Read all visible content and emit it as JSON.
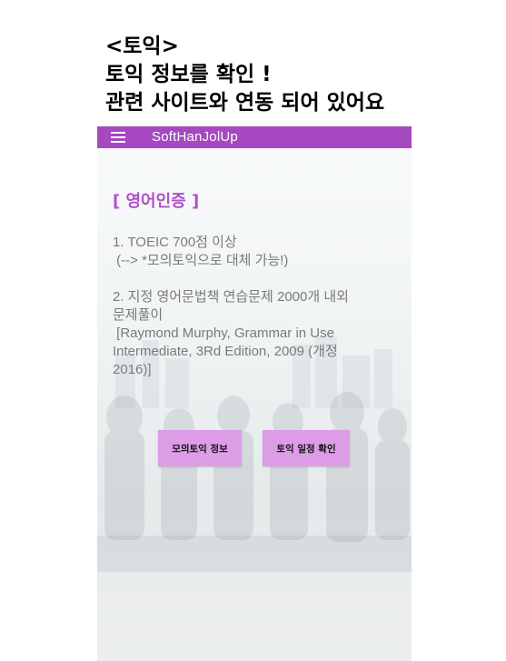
{
  "caption": {
    "line1": "<토익>",
    "line2": "토익 정보를 확인 !",
    "line3": "관련 사이트와 연동 되어 있어요"
  },
  "appbar": {
    "title": "SoftHanJolUp",
    "menu_icon": "hamburger-menu-icon"
  },
  "content": {
    "section_title": "[ 영어인증 ]",
    "item1_line1": "1. TOEIC 700점 이상",
    "item1_line2": " (--> *모의토익으로 대체 가능!)",
    "item2_line1": "2. 지정 영어문법책 연습문제 2000개 내외",
    "item2_line2": "문제풀이",
    "item2_line3": " [Raymond Murphy, Grammar in Use",
    "item2_line4": "Intermediate, 3Rd Edition, 2009 (개정",
    "item2_line5": "2016)]"
  },
  "buttons": {
    "mock_toeic": "모의토익 정보",
    "toeic_schedule": "토익 일정 확인"
  },
  "colors": {
    "appbar": "#a648bf",
    "section_title": "#b04fce",
    "button": "#dc9de6"
  }
}
